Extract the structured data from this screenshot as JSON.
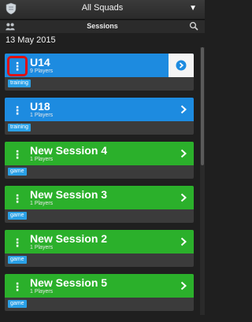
{
  "header": {
    "title": "All Squads"
  },
  "subheader": {
    "title": "Sessions"
  },
  "date_label": "13 May 2015",
  "sessions": [
    {
      "name": "U14",
      "players": "9 Players",
      "tag": "training"
    },
    {
      "name": "U18",
      "players": "1 Players",
      "tag": "training"
    },
    {
      "name": "New Session 4",
      "players": "1 Players",
      "tag": "game"
    },
    {
      "name": "New Session 3",
      "players": "1 Players",
      "tag": "game"
    },
    {
      "name": "New Session 2",
      "players": "1 Players",
      "tag": "game"
    },
    {
      "name": "New Session 5",
      "players": "1 Players",
      "tag": "game"
    }
  ],
  "colors": {
    "blue": "#1d8be0",
    "green": "#2bb02b",
    "tag": "#2aa0e6",
    "highlight": "#e01010"
  },
  "icons": {
    "logo": "shield-icon",
    "caret": "caret-down-icon",
    "people": "people-icon",
    "search": "search-icon",
    "menu": "vertical-dots-icon",
    "chevron": "chevron-right-icon"
  }
}
